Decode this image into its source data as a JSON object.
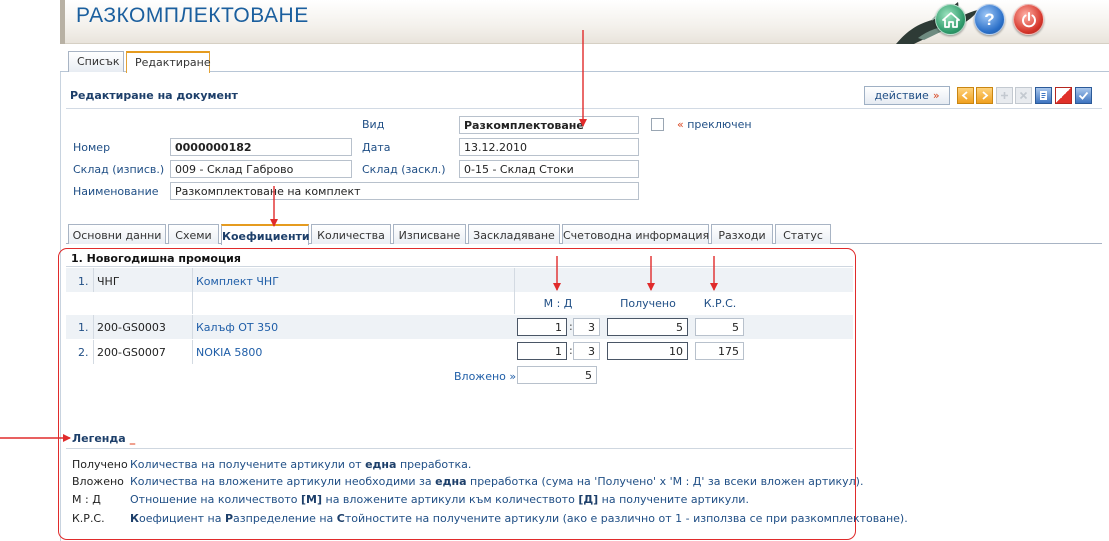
{
  "app": {
    "title": "РАЗКОМПЛЕКТОВАНЕ"
  },
  "header_buttons": {
    "home_icon": "home-icon",
    "help_label": "?",
    "power_icon": "power-icon"
  },
  "top_tabs": [
    {
      "label": "Списък"
    },
    {
      "label": "Редактиране"
    }
  ],
  "panel": {
    "title": "Редактиране на документ",
    "action_label": "действие",
    "action_arrow": "»",
    "toolbar_icons": [
      "arrow-left-icon",
      "arrow-right-icon",
      "add-icon",
      "delete-icon",
      "print-icon",
      "cancel-icon",
      "confirm-icon"
    ]
  },
  "form": {
    "vid_label": "Вид",
    "vid_value": "Разкомплектоване",
    "switched_label": "преключен",
    "switched_prefix": "«",
    "nomer_label": "Номер",
    "nomer_value": "0000000182",
    "data_label": "Дата",
    "data_value": "13.12.2010",
    "sklad_out_label": "Склад (изписв.)",
    "sklad_out_value": "009 - Склад Габрово",
    "sklad_in_label": "Склад (заскл.)",
    "sklad_in_value": "0-15 - Склад Стоки",
    "name_label": "Наименование",
    "name_value": "Разкомплектоване на комплект"
  },
  "sub_tabs": [
    {
      "label": "Основни данни"
    },
    {
      "label": "Схеми"
    },
    {
      "label": "Коефициенти"
    },
    {
      "label": "Количества"
    },
    {
      "label": "Изписване"
    },
    {
      "label": "Заскладяване"
    },
    {
      "label": "Счетоводна информация"
    },
    {
      "label": "Разходи"
    },
    {
      "label": "Статус"
    }
  ],
  "coefficients": {
    "section_title": "1. Новогодишна промоция",
    "kit": {
      "num": "1.",
      "code": "ЧНГ",
      "name": "Комплект ЧНГ"
    },
    "headers": {
      "md": "М : Д",
      "received": "Получено",
      "krs": "К.Р.С."
    },
    "rows": [
      {
        "num": "1.",
        "code": "200-GS0003",
        "name": "Калъф ОТ 350",
        "m": "1",
        "d": "3",
        "received": "5",
        "krs": "5"
      },
      {
        "num": "2.",
        "code": "200-GS0007",
        "name": "NOKIA 5800",
        "m": "1",
        "d": "3",
        "received": "10",
        "krs": "175"
      }
    ],
    "inserted_label": "Вложено »",
    "inserted_value": "5"
  },
  "legend": {
    "title": "Легенда",
    "marker": "_",
    "items": [
      {
        "term": "Получено",
        "parts": [
          "Количества на получените артикули от ",
          "една",
          " преработка."
        ]
      },
      {
        "term": "Вложено",
        "parts": [
          "Количества на вложените артикули необходими за ",
          "една",
          " преработка (сума на 'Получено' x 'М : Д' за всеки вложен артикул)."
        ]
      },
      {
        "term": "М : Д",
        "parts": [
          "Отношение на количеството ",
          "[М]",
          " на вложените артикули към количеството ",
          "[Д]",
          " на получените артикули."
        ]
      },
      {
        "term": "К.Р.С.",
        "parts": [
          "К",
          "оефициент на ",
          "Р",
          "азпределение на ",
          "С",
          "тойностите на получените артикули (ако е различно от 1 - използва се при разкомплектоване)."
        ]
      }
    ]
  },
  "colors": {
    "accent": "#1f4e85",
    "highlight": "#e02b2b",
    "tab_active": "#e59b1f"
  }
}
